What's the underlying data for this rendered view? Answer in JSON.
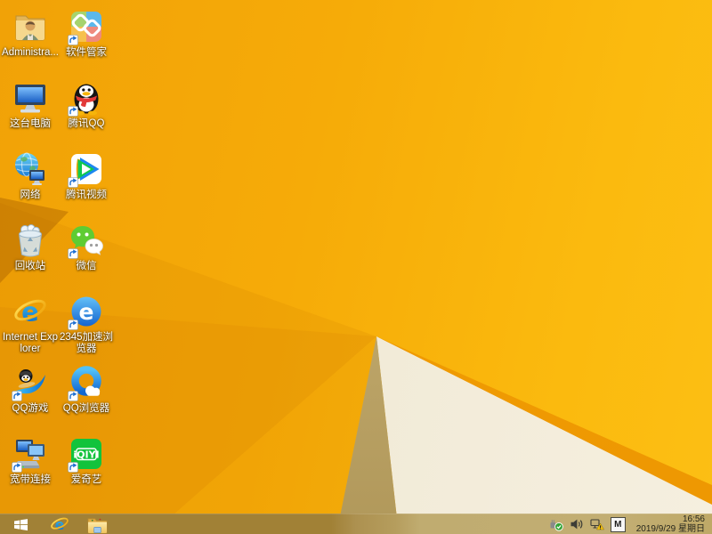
{
  "wallpaper": {
    "style": "windows-8.1-orange-polygon-folds",
    "colors": {
      "base_orange": "#f6ab08",
      "bright_yellow": "#fcbf14",
      "deep_fold_wedge": "#dd8d06",
      "fold_stripe": "#ee9702",
      "cream_triangle": "#f2ebd8",
      "khaki_triangle": "#c2ab6e"
    }
  },
  "desktop": {
    "icons": [
      {
        "label": "Administra...",
        "name": "administrator-folder",
        "icon": "user-folder",
        "shortcut": false,
        "col": 0,
        "row": 0
      },
      {
        "label": "软件管家",
        "name": "software-manager",
        "icon": "software-manager",
        "shortcut": true,
        "col": 1,
        "row": 0
      },
      {
        "label": "这台电脑",
        "name": "this-pc",
        "icon": "computer",
        "shortcut": false,
        "col": 0,
        "row": 1
      },
      {
        "label": "腾讯QQ",
        "name": "tencent-qq",
        "icon": "qq-penguin",
        "shortcut": true,
        "col": 1,
        "row": 1
      },
      {
        "label": "网络",
        "name": "network",
        "icon": "network-globe",
        "shortcut": false,
        "col": 0,
        "row": 2
      },
      {
        "label": "腾讯视频",
        "name": "tencent-video",
        "icon": "tencent-video",
        "shortcut": true,
        "col": 1,
        "row": 2
      },
      {
        "label": "回收站",
        "name": "recycle-bin",
        "icon": "recycle-bin",
        "shortcut": false,
        "col": 0,
        "row": 3
      },
      {
        "label": "微信",
        "name": "wechat",
        "icon": "wechat-bubbles",
        "shortcut": true,
        "col": 1,
        "row": 3
      },
      {
        "label": "Internet Explorer",
        "name": "internet-explorer",
        "icon": "ie-logo",
        "shortcut": false,
        "col": 0,
        "row": 4
      },
      {
        "label": "2345加速浏览器",
        "name": "browser-2345",
        "icon": "blue-e-circle",
        "shortcut": true,
        "col": 1,
        "row": 4
      },
      {
        "label": "QQ游戏",
        "name": "qq-games",
        "icon": "qq-game-penguin",
        "shortcut": true,
        "col": 0,
        "row": 5
      },
      {
        "label": "QQ浏览器",
        "name": "qq-browser",
        "icon": "blue-ring-cloud",
        "shortcut": true,
        "col": 1,
        "row": 5
      },
      {
        "label": "宽带连接",
        "name": "broadband-connection",
        "icon": "two-computers-modem",
        "shortcut": true,
        "col": 0,
        "row": 6
      },
      {
        "label": "爱奇艺",
        "name": "iqiyi",
        "icon": "iqiyi-tile",
        "shortcut": true,
        "col": 1,
        "row": 6
      }
    ]
  },
  "taskbar": {
    "start_button": {
      "name": "start",
      "icon": "windows-logo"
    },
    "pinned": [
      {
        "name": "internet-explorer",
        "icon": "ie-logo-small"
      },
      {
        "name": "file-explorer",
        "icon": "folder"
      }
    ],
    "tray": {
      "icons": [
        {
          "name": "usb-device",
          "icon": "usb-check"
        },
        {
          "name": "volume",
          "icon": "speaker"
        },
        {
          "name": "network-status",
          "icon": "network-warning"
        },
        {
          "name": "input-method",
          "icon": "ime-box",
          "label": "M"
        }
      ],
      "clock": {
        "time": "16:56",
        "date": "2019/9/29 星期日"
      }
    }
  },
  "brands": {
    "iqiyi_logo_text": "iQIYI"
  }
}
